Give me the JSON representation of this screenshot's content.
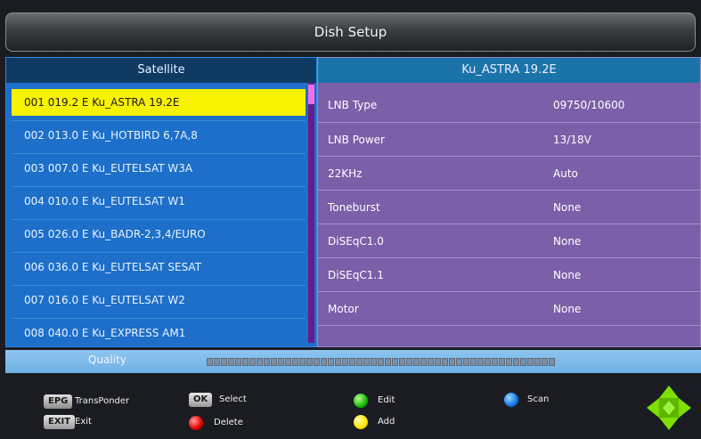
{
  "title": "Dish Setup",
  "left_panel": {
    "header": "Satellite",
    "items": [
      {
        "label": "001 019.2 E  Ku_ASTRA 19.2E",
        "selected": true
      },
      {
        "label": "002 013.0 E  Ku_HOTBIRD 6,7A,8"
      },
      {
        "label": "003 007.0 E  Ku_EUTELSAT W3A"
      },
      {
        "label": "004 010.0 E  Ku_EUTELSAT W1"
      },
      {
        "label": "005 026.0 E  Ku_BADR-2,3,4/EURO"
      },
      {
        "label": "006 036.0 E  Ku_EUTELSAT SESAT"
      },
      {
        "label": "007 016.0 E  Ku_EUTELSAT W2"
      },
      {
        "label": "008 040.0 E  Ku_EXPRESS AM1"
      }
    ]
  },
  "right_panel": {
    "header": "Ku_ASTRA 19.2E",
    "rows": [
      {
        "label": "LNB Type",
        "value": "09750/10600"
      },
      {
        "label": "LNB Power",
        "value": "13/18V"
      },
      {
        "label": "22KHz",
        "value": "Auto"
      },
      {
        "label": "Toneburst",
        "value": "None"
      },
      {
        "label": "DiSEqC1.0",
        "value": "None"
      },
      {
        "label": "DiSEqC1.1",
        "value": "None"
      },
      {
        "label": "Motor",
        "value": "None"
      }
    ]
  },
  "quality": {
    "label": "Quality",
    "level": 0
  },
  "footer": {
    "epg_key": "EPG",
    "epg_label": "TransPonder",
    "exit_key": "EXIT",
    "exit_label": "Exit",
    "ok_key": "OK",
    "ok_label": "Select",
    "red_label": "Delete",
    "green_label": "Edit",
    "yellow_label": "Add",
    "blue_label": "Scan"
  },
  "colors": {
    "selected": "#f6f200",
    "left_bg": "#1d6fc9",
    "right_bg": "#7b5fa8",
    "dpad": "#7ce000"
  },
  "icons": {
    "red": "red-button-icon",
    "green": "green-button-icon",
    "yellow": "yellow-button-icon",
    "blue": "blue-button-icon",
    "nav": "navigation-arrows-icon"
  }
}
